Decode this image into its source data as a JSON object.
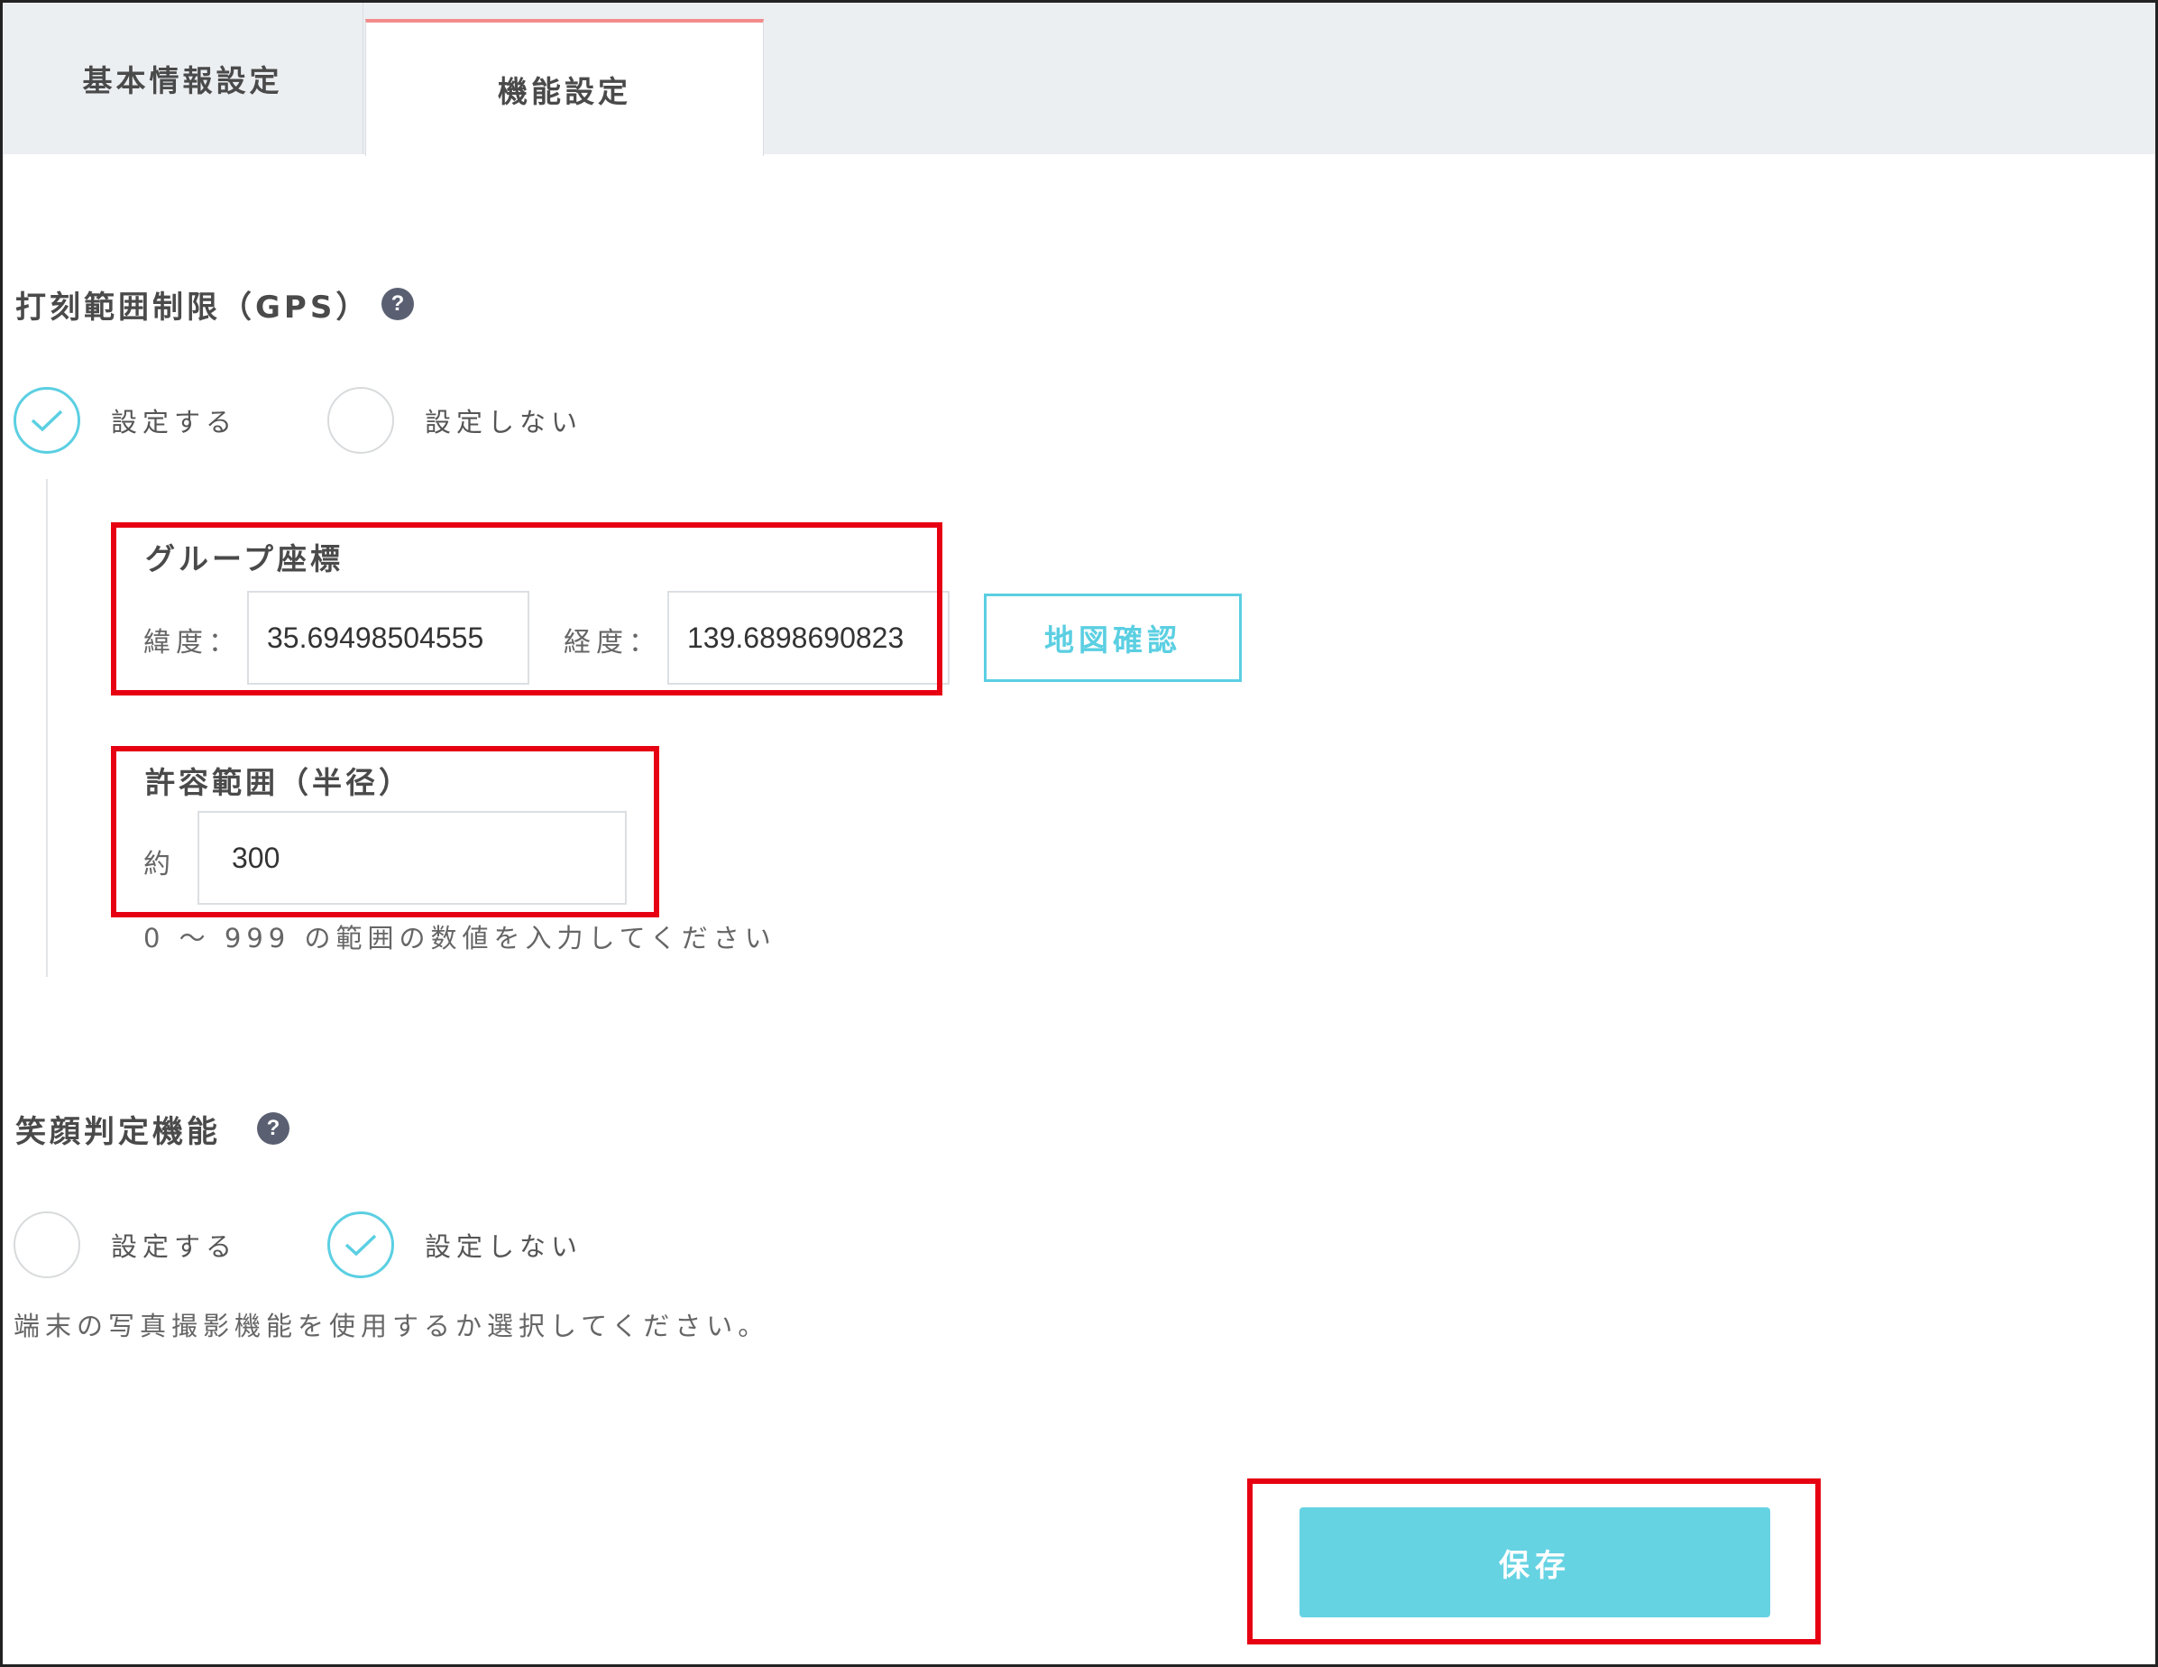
{
  "tabs": {
    "basic": "基本情報設定",
    "function": "機能設定",
    "active": "function"
  },
  "gps": {
    "title": "打刻範囲制限（GPS）",
    "help": "?",
    "options": {
      "on": "設定する",
      "off": "設定しない"
    },
    "selected": "on",
    "coords": {
      "heading": "グループ座標",
      "lat_label": "緯度：",
      "lat_value": "35.69498504555",
      "lng_label": "経度：",
      "lng_value": "139.6898690823",
      "map_button": "地図確認"
    },
    "radius": {
      "heading": "許容範囲（半径）",
      "prefix": "約",
      "value": "300",
      "hint": "0 〜 999 の範囲の数値を入力してください"
    }
  },
  "smile": {
    "title": "笑顔判定機能",
    "help": "?",
    "options": {
      "on": "設定する",
      "off": "設定しない"
    },
    "selected": "off",
    "description": "端末の写真撮影機能を使用するか選択してください。"
  },
  "save_button": "保存",
  "colors": {
    "accent": "#5bcfe2",
    "save_bg": "#66d3e3",
    "highlight": "#e60012",
    "tab_indicator": "#f28b8b",
    "tab_bar_bg": "#eceff2"
  }
}
